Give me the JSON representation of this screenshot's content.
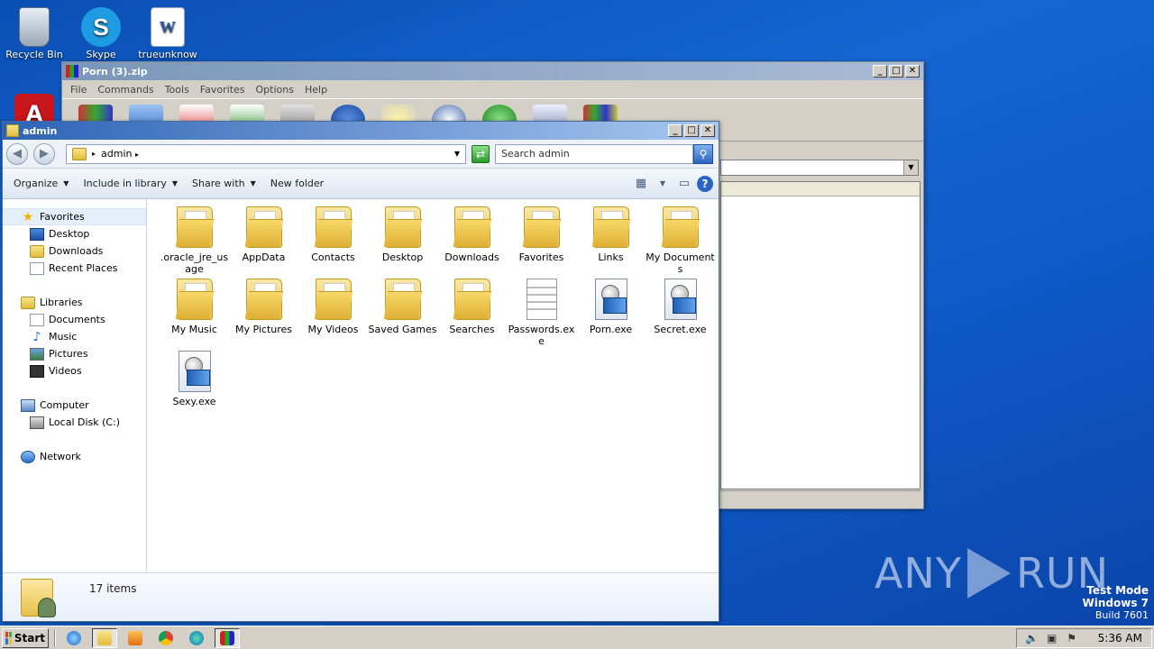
{
  "desktop": {
    "icons": [
      {
        "label": "Recycle Bin"
      },
      {
        "label": "Skype"
      },
      {
        "label": "trueunknow"
      }
    ],
    "watermark": {
      "left": "ANY",
      "right": "RUN"
    },
    "test_mode": {
      "line1": "Test Mode",
      "line2": "Windows 7",
      "line3": "Build 7601"
    }
  },
  "winrar": {
    "title": "Porn (3).zip",
    "menu": [
      "File",
      "Commands",
      "Tools",
      "Favorites",
      "Options",
      "Help"
    ]
  },
  "explorer": {
    "title": "admin",
    "address": "admin",
    "search_placeholder": "Search admin",
    "commands": {
      "organize": "Organize",
      "include_library": "Include in library",
      "share_with": "Share with",
      "new_folder": "New folder"
    },
    "nav": {
      "favorites": "Favorites",
      "desktop": "Desktop",
      "downloads": "Downloads",
      "recent_places": "Recent Places",
      "libraries": "Libraries",
      "documents": "Documents",
      "music": "Music",
      "pictures": "Pictures",
      "videos": "Videos",
      "computer": "Computer",
      "local_disk": "Local Disk (C:)",
      "network": "Network"
    },
    "items": [
      {
        "name": ".oracle_jre_usage",
        "type": "folder"
      },
      {
        "name": "AppData",
        "type": "folder"
      },
      {
        "name": "Contacts",
        "type": "folder"
      },
      {
        "name": "Desktop",
        "type": "folder"
      },
      {
        "name": "Downloads",
        "type": "folder"
      },
      {
        "name": "Favorites",
        "type": "folder"
      },
      {
        "name": "Links",
        "type": "folder"
      },
      {
        "name": "My Documents",
        "type": "folder"
      },
      {
        "name": "My Music",
        "type": "folder"
      },
      {
        "name": "My Pictures",
        "type": "folder"
      },
      {
        "name": "My Videos",
        "type": "folder"
      },
      {
        "name": "Saved Games",
        "type": "folder"
      },
      {
        "name": "Searches",
        "type": "folder"
      },
      {
        "name": "Passwords.exe",
        "type": "txt"
      },
      {
        "name": "Porn.exe",
        "type": "exe"
      },
      {
        "name": "Secret.exe",
        "type": "exe"
      },
      {
        "name": "Sexy.exe",
        "type": "exe"
      }
    ],
    "status_count": "17 items"
  },
  "taskbar": {
    "start_label": "Start",
    "clock": "5:36 AM"
  }
}
